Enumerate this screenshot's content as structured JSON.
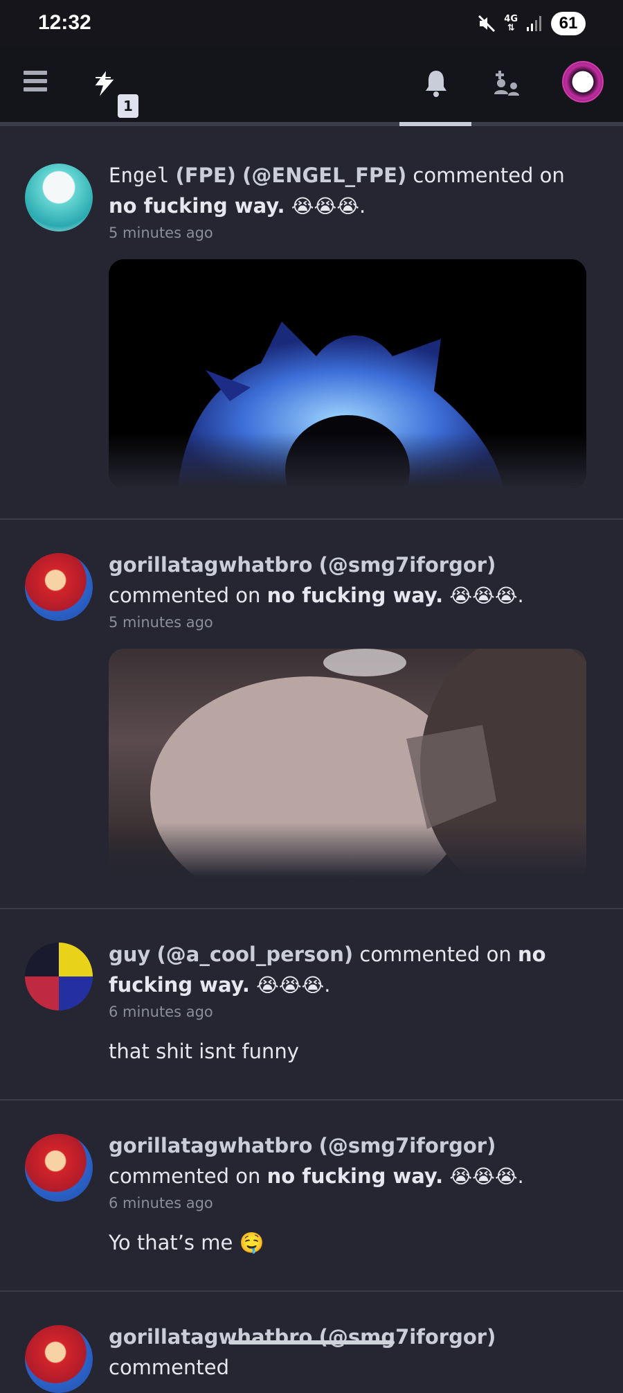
{
  "status_bar": {
    "time": "12:32",
    "network": "4G",
    "battery": "61"
  },
  "app_bar": {
    "badge_count": "1"
  },
  "colors": {
    "background": "#252631",
    "app_bar": "#14141b",
    "accent": "#c9ccd9"
  },
  "notifications": [
    {
      "name": "Engel",
      "name_rest": "(FPE)",
      "handle": "(@ENGEL_FPE)",
      "action": "commented on",
      "post_title": "no fucking way.",
      "emoji": "😭😭😭",
      "period": ".",
      "time": "5 minutes ago",
      "media": "image"
    },
    {
      "name": "gorillatagwhatbro",
      "handle": "(@smg7iforgor)",
      "action": "commented on",
      "post_title": "no fucking way.",
      "emoji": "😭😭😭",
      "period": ".",
      "time": "5 minutes ago",
      "media": "image"
    },
    {
      "name": "guy",
      "handle": "(@a_cool_person)",
      "action": "commented on",
      "post_title": "no fucking way.",
      "emoji": "😭😭😭",
      "period": ".",
      "time": "6 minutes ago",
      "comment": "that shit isnt funny"
    },
    {
      "name": "gorillatagwhatbro",
      "handle": "(@smg7iforgor)",
      "action": "commented on",
      "post_title": "no fucking way.",
      "emoji": "😭😭😭",
      "period": ".",
      "time": "6 minutes ago",
      "comment": "Yo that’s me 🤤"
    },
    {
      "name": "gorillatagwhatbro",
      "handle": "(@smg7iforgor)",
      "action": "commented"
    }
  ]
}
